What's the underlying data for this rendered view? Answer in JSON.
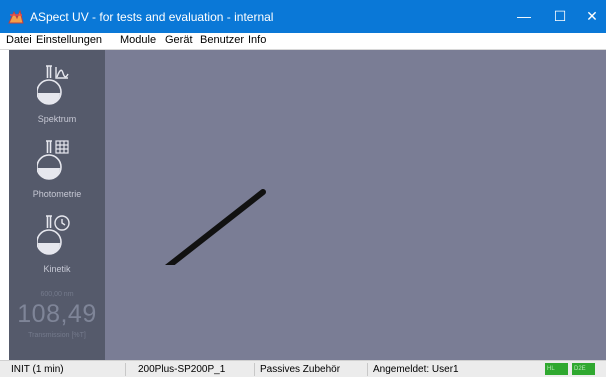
{
  "window": {
    "title": "ASpect UV - for tests and evaluation - internal",
    "minimize_glyph": "—",
    "maximize_glyph": "☐",
    "close_glyph": "✕"
  },
  "menu": {
    "items": [
      "Datei",
      "Einstellungen",
      "Module",
      "Gerät",
      "Benutzer",
      "Info"
    ]
  },
  "sidebar": {
    "modules": [
      {
        "label": "Spektrum",
        "icon": "flask-spectrum-icon"
      },
      {
        "label": "Photometrie",
        "icon": "flask-photometry-icon"
      },
      {
        "label": "Kinetik",
        "icon": "flask-kinetics-icon"
      }
    ],
    "measurement": {
      "wavelength": "600,00 nm",
      "value": "108,49",
      "unit": "Transmission [%T]"
    }
  },
  "statusbar": {
    "init": "INIT (1 min)",
    "device": "200Plus-SP200P_1",
    "accessory": "Passives Zubehör",
    "user": "Angemeldet: User1",
    "indicators": [
      "HL",
      "D2E"
    ]
  },
  "colors": {
    "titlebar": "#0a78d7",
    "sidebar": "#555a6b",
    "workspace": "#7a7d95",
    "indicator": "#2fa82f"
  }
}
